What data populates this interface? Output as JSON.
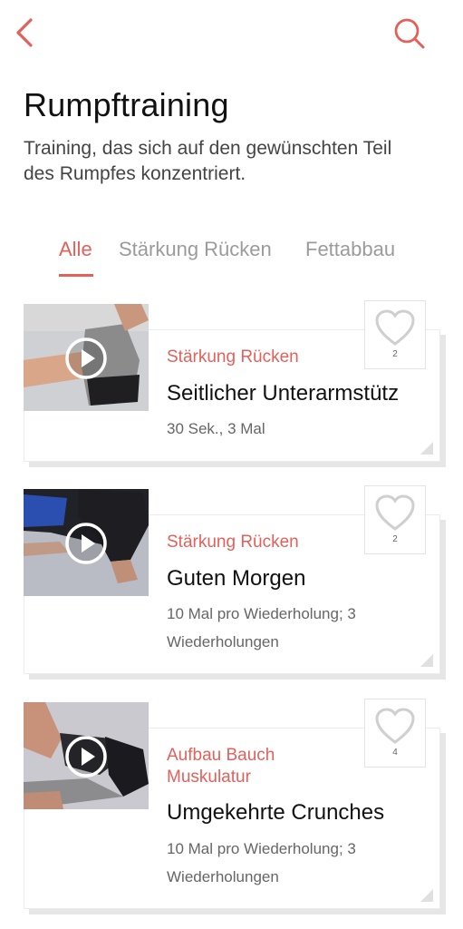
{
  "header": {
    "back_icon": "back-chevron-icon",
    "search_icon": "search-icon",
    "accent_color": "#e4605a"
  },
  "page": {
    "title": "Rumpftraining",
    "subtitle": "Training, das sich auf den gewünschten Teil des Rumpfes konzentriert."
  },
  "tabs": [
    {
      "label": "Alle",
      "active": true
    },
    {
      "label": "Stärkung Rücken",
      "active": false
    },
    {
      "label": "Fettabbau",
      "active": false
    }
  ],
  "exercises": [
    {
      "category": "Stärkung Rücken",
      "name": "Seitlicher Unterarmstütz",
      "details": "30 Sek., 3 Mal",
      "likes": "2"
    },
    {
      "category": "Stärkung Rücken",
      "name": "Guten Morgen",
      "details": "10 Mal pro Wiederholung; 3 Wiederholungen",
      "likes": "2"
    },
    {
      "category": "Aufbau Bauch Muskulatur",
      "name": "Umgekehrte Crunches",
      "details": "10 Mal pro Wiederholung; 3 Wiederholungen",
      "likes": "4"
    }
  ]
}
